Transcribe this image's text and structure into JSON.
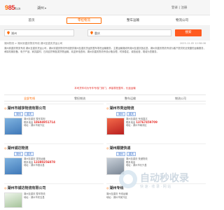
{
  "header": {
    "logo_a": "9",
    "logo_b": "85",
    "logo_c": "ft.cn",
    "city": "湖州",
    "login": "登录 | 注册"
  },
  "nav": [
    "首页",
    "零担物流",
    "整车运输",
    "物流公司"
  ],
  "search": {
    "city_value": "湖州",
    "dest_value": "重庆",
    "button": "搜索"
  },
  "breadcrumb": "湖州物流 > 湖州到重庆物流专线  湖州至重庆货运公司",
  "date": "2025-12-05 12:58:08",
  "intro": "湖州到重庆物流专线  湖州至重庆货运公司，湖州到重庆物流专线提供湖州至重庆货运的整车零担运输服务，主要运输路线有湖州至重庆各区县，湖州到重庆物流专线为客户提供安全快捷的运输服务，承接机械设备、电子产品、家具建材、日用百货等各类货物运输，欢迎来电咨询，湖州到重庆物流专线价格合理，时效稳定，诚信经营，竭诚为您服务。",
  "notice": "本司货车均为专车专线门到门，承接零担整车，长途运输",
  "categories": [
    "全部专线",
    "零担物流",
    "整车运输",
    "物流公司"
  ],
  "cards": [
    {
      "title": "湖州市越享物流有限公司",
      "tag1": "湖州",
      "tag2": "重庆",
      "line1": "湖州至重庆 整车零担",
      "line2": "联系电话",
      "phone": "18604951714",
      "line3": "地址：湖州市吴兴区"
    },
    {
      "title": "湖州市英运物流",
      "tag1": "湖州",
      "tag2": "重庆",
      "line1": "湖州至重庆 专线直达",
      "line2": "联系电话",
      "phone": "13767459709",
      "line3": "地址：湖州市南浔区"
    },
    {
      "title": "湖州诚达物流",
      "tag1": "湖州",
      "tag2": "重庆",
      "line1": "湖州至重庆 零担运输",
      "line2": "联系电话",
      "phone": "13380256078",
      "line3": "地址：湖州市德清县"
    },
    {
      "title": "湖州顺捷快递",
      "tag1": "湖州",
      "tag2": "重庆",
      "line1": "湖州至重庆 快递物流",
      "line2": "联系电话",
      "phone": "",
      "line3": "地址：湖州市长兴县"
    },
    {
      "title": "湖州市诚达物流有限公司",
      "tag1": "湖州",
      "tag2": "重庆",
      "line1": "湖州至重庆 整车物流",
      "line2": "联系电话",
      "phone": "",
      "line3": "地址：湖州市安吉县"
    },
    {
      "title": "湖州专线",
      "tag1": "湖州",
      "tag2": "重庆",
      "line1": "湖州至重庆 专线运输",
      "line2": "联系电话",
      "phone": "",
      "line3": "地址：湖州市吴兴区"
    }
  ],
  "watermark": {
    "title": "自动秒收录",
    "sub": "快 速 · 收 录 · 网 站"
  }
}
